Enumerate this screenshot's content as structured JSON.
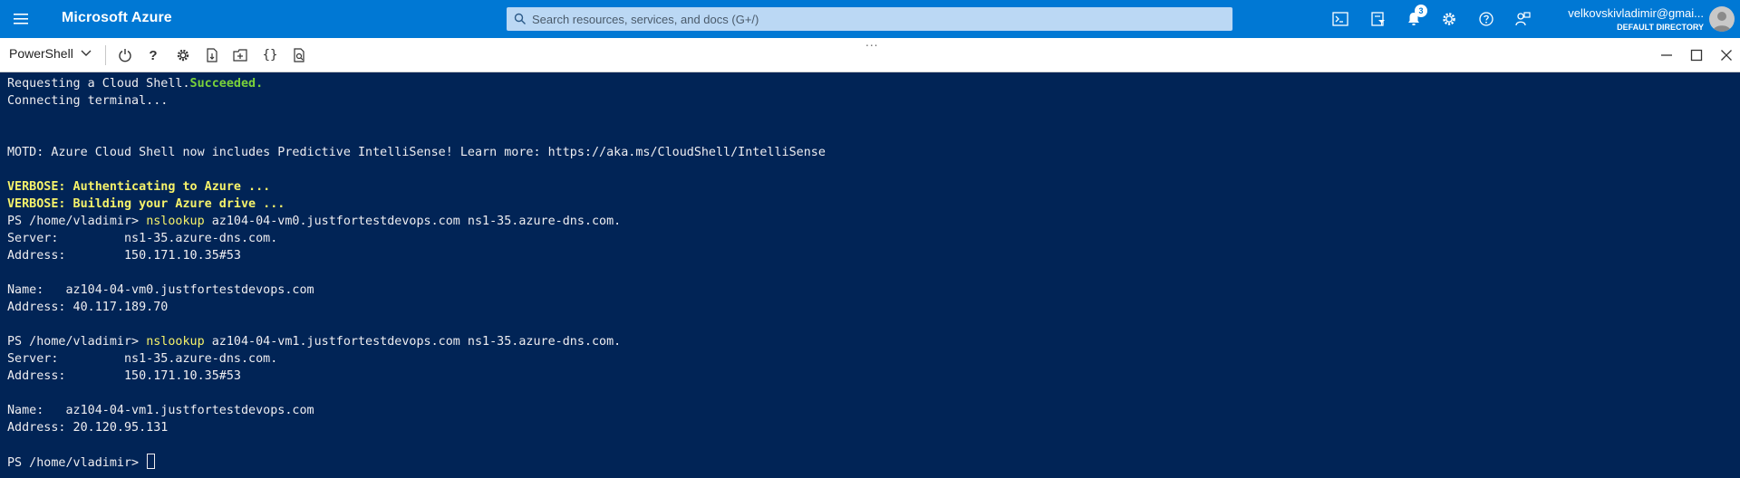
{
  "topbar": {
    "brand": "Microsoft Azure",
    "search_placeholder": "Search resources, services, and docs (G+/)",
    "notification_count": "3",
    "account_name": "velkovskivladimir@gmai...",
    "account_directory": "DEFAULT DIRECTORY",
    "icons": [
      "cloud-shell-icon",
      "directory-filter-icon",
      "notifications-icon",
      "settings-icon",
      "help-icon",
      "feedback-icon"
    ]
  },
  "shell_toolbar": {
    "shell_type": "PowerShell",
    "grip": "...",
    "icons": [
      "power-icon",
      "help-icon",
      "settings-icon",
      "upload-download-icon",
      "open-new-session-icon",
      "editor-braces-icon",
      "web-preview-icon"
    ],
    "help_glyph": "?",
    "braces_glyph": "{}"
  },
  "terminal": {
    "l1_prefix": "Requesting a Cloud Shell.",
    "l1_status": "Succeeded.",
    "l2": "Connecting terminal...",
    "l3": "MOTD: Azure Cloud Shell now includes Predictive IntelliSense! Learn more: https://aka.ms/CloudShell/IntelliSense",
    "l4": "VERBOSE: Authenticating to Azure ...",
    "l5": "VERBOSE: Building your Azure drive ...",
    "prompt": "PS /home/vladimir> ",
    "cmd_name": "nslookup",
    "cmd1_args": " az104-04-vm0.justfortestdevops.com ns1-35.azure-dns.com.",
    "server1": "Server:         ns1-35.azure-dns.com.",
    "address1": "Address:        150.171.10.35#53",
    "name1": "Name:   az104-04-vm0.justfortestdevops.com",
    "addr_result1": "Address: 40.117.189.70",
    "cmd2_args": " az104-04-vm1.justfortestdevops.com ns1-35.azure-dns.com.",
    "server2": "Server:         ns1-35.azure-dns.com.",
    "address2": "Address:        150.171.10.35#53",
    "name2": "Name:   az104-04-vm1.justfortestdevops.com",
    "addr_result2": "Address: 20.120.95.131",
    "final_prompt": "PS /home/vladimir> "
  },
  "colors": {
    "azure_blue": "#0078d4",
    "terminal_bg": "#012456",
    "success_green": "#7ad23a",
    "verbose_yellow": "#f6f26a"
  }
}
